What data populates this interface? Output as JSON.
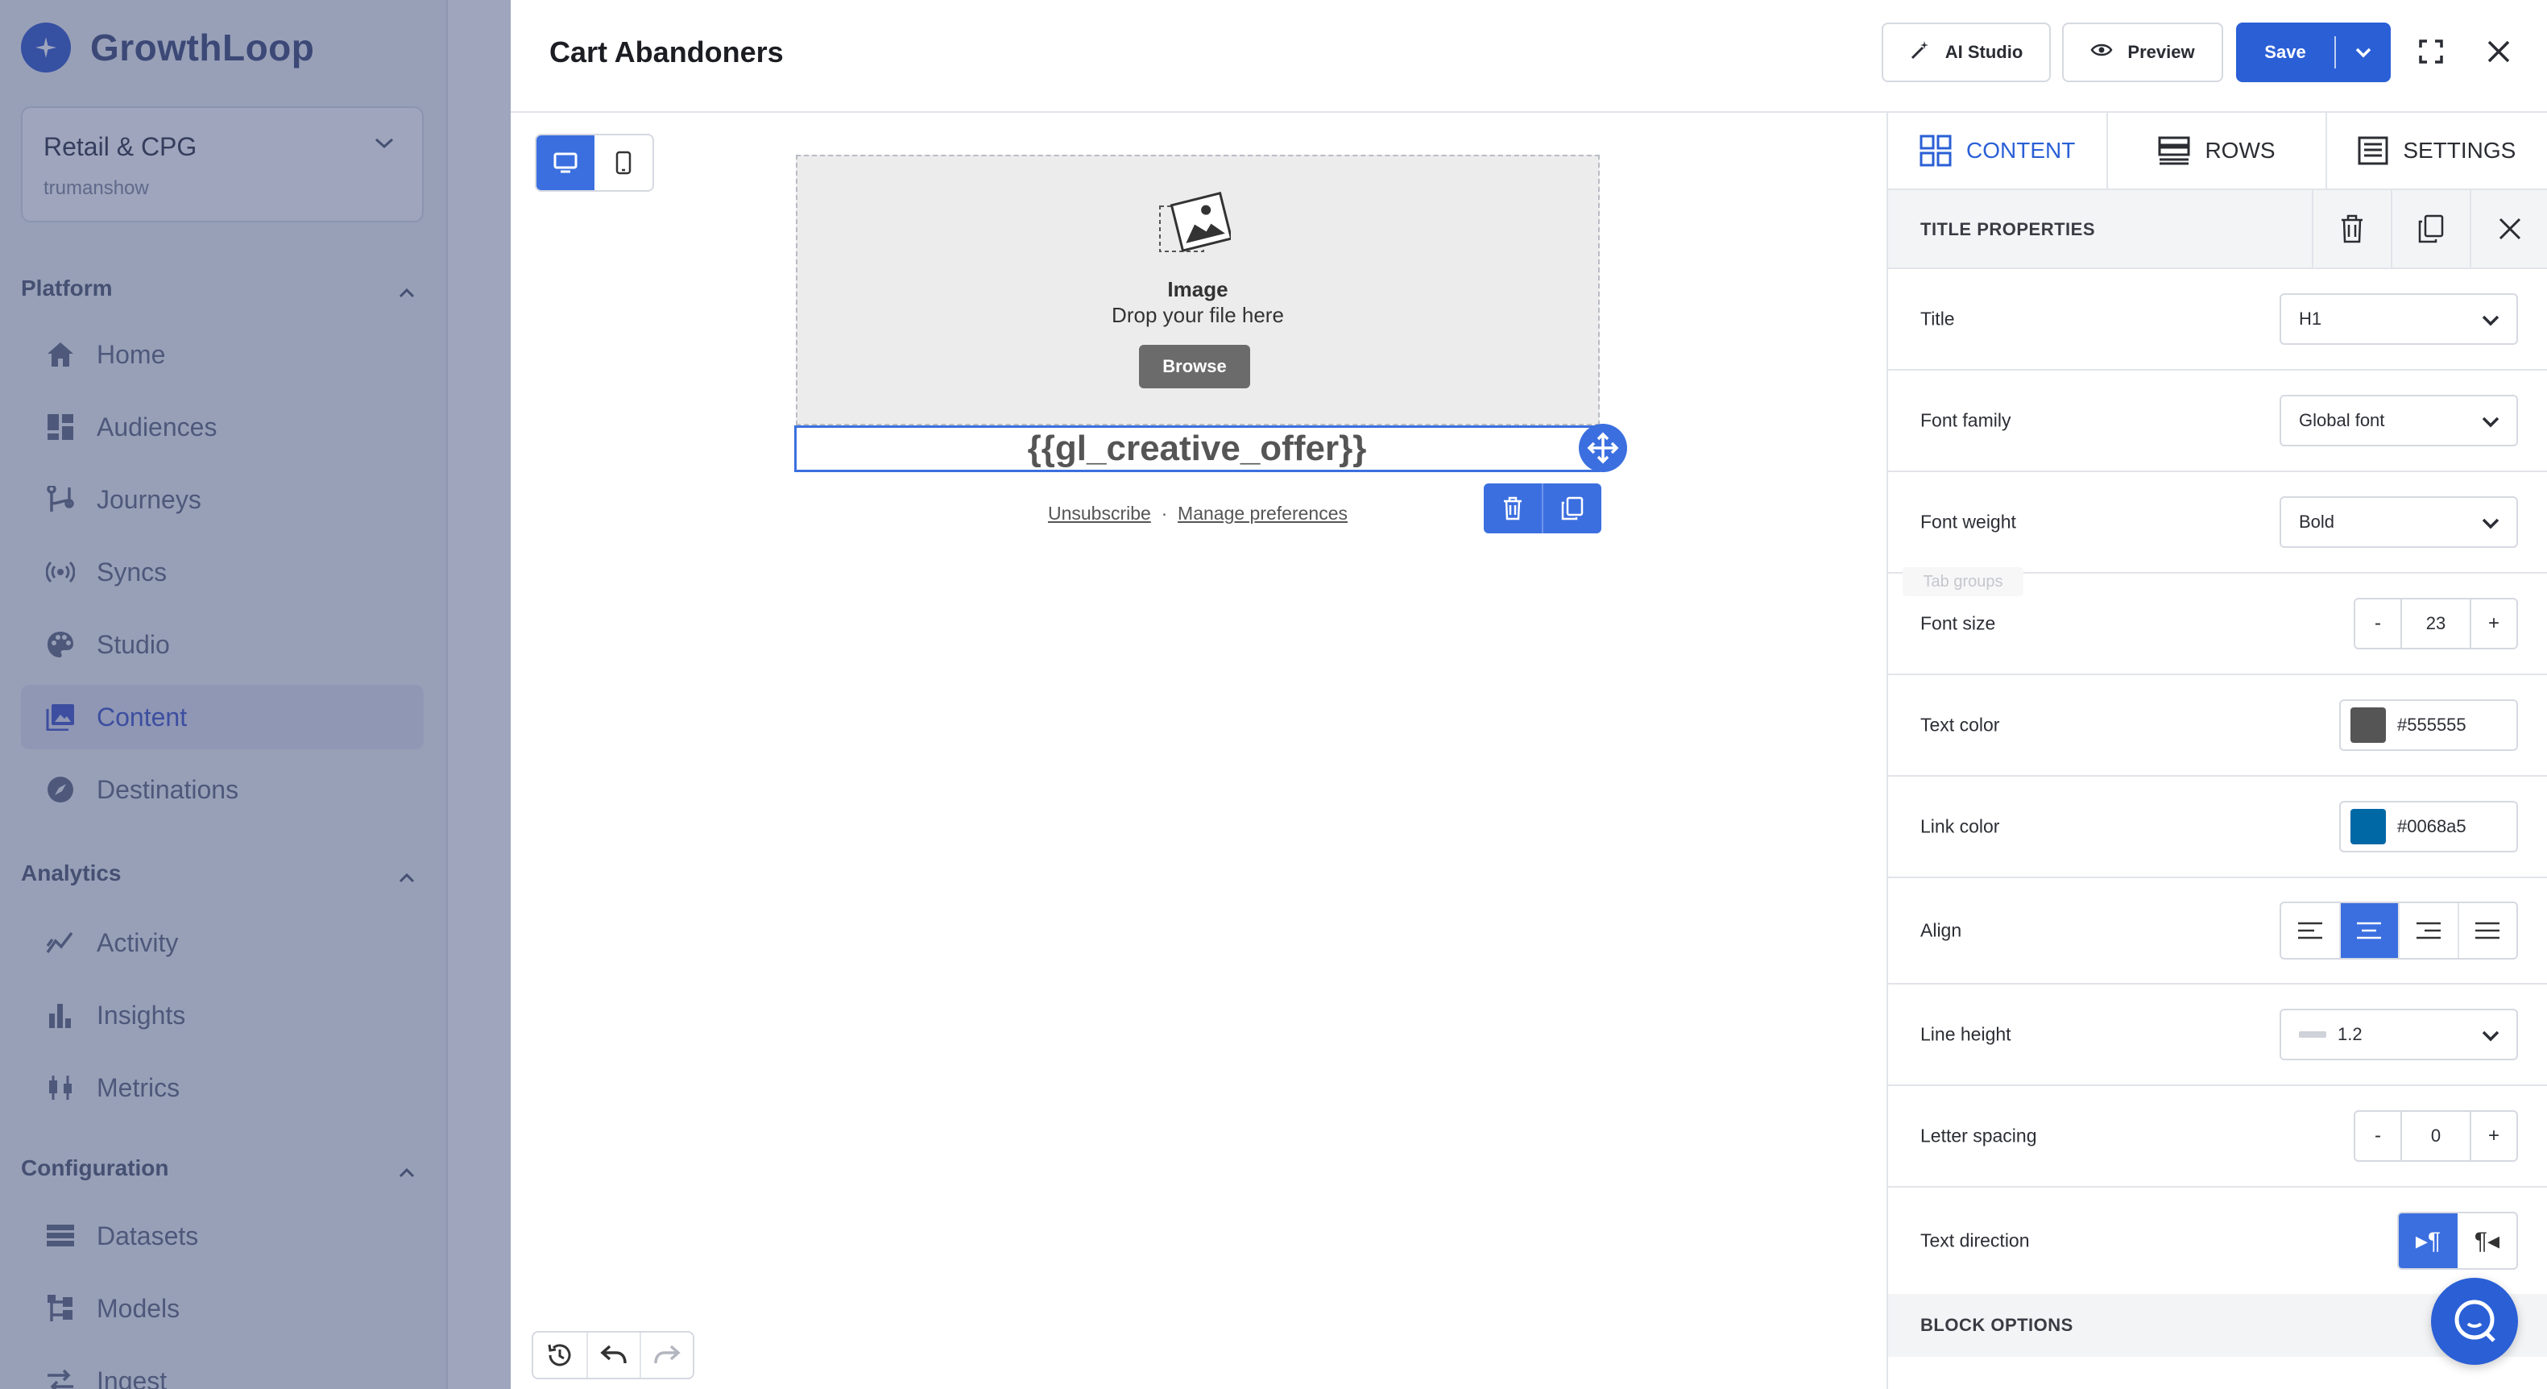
{
  "sidebar": {
    "brand": "GrowthLoop",
    "workspace": {
      "name": "Retail & CPG",
      "user": "trumanshow"
    },
    "sections": [
      {
        "title": "Platform",
        "items": [
          {
            "label": "Home",
            "icon": "home-icon"
          },
          {
            "label": "Audiences",
            "icon": "grid-icon"
          },
          {
            "label": "Journeys",
            "icon": "journey-icon"
          },
          {
            "label": "Syncs",
            "icon": "broadcast-icon"
          },
          {
            "label": "Studio",
            "icon": "palette-icon"
          },
          {
            "label": "Content",
            "icon": "image-icon",
            "active": true
          },
          {
            "label": "Destinations",
            "icon": "compass-icon"
          }
        ]
      },
      {
        "title": "Analytics",
        "items": [
          {
            "label": "Activity",
            "icon": "activity-icon"
          },
          {
            "label": "Insights",
            "icon": "bar-chart-icon"
          },
          {
            "label": "Metrics",
            "icon": "metrics-icon"
          }
        ]
      },
      {
        "title": "Configuration",
        "items": [
          {
            "label": "Datasets",
            "icon": "database-icon"
          },
          {
            "label": "Models",
            "icon": "model-icon"
          },
          {
            "label": "Ingest",
            "icon": "ingest-icon"
          }
        ]
      }
    ]
  },
  "editor": {
    "title": "Cart Abandoners",
    "toolbar": {
      "ai_studio": "AI Studio",
      "preview": "Preview",
      "save": "Save"
    },
    "canvas": {
      "image_block": {
        "label": "Image",
        "drop_text": "Drop your file here",
        "browse": "Browse"
      },
      "title_text": "{{gl_creative_offer}}",
      "footer": {
        "unsubscribe": "Unsubscribe",
        "separator": "·",
        "manage": "Manage preferences"
      }
    }
  },
  "panel": {
    "tabs": [
      "CONTENT",
      "ROWS",
      "SETTINGS"
    ],
    "active_tab": "CONTENT",
    "header": "TITLE PROPERTIES",
    "tooltip_ghost": "Tab groups",
    "properties": {
      "title": {
        "label": "Title",
        "value": "H1"
      },
      "font_family": {
        "label": "Font family",
        "value": "Global font"
      },
      "font_weight": {
        "label": "Font weight",
        "value": "Bold"
      },
      "font_size": {
        "label": "Font size",
        "value": "23",
        "minus": "-",
        "plus": "+"
      },
      "text_color": {
        "label": "Text color",
        "value": "#555555"
      },
      "link_color": {
        "label": "Link color",
        "value": "#0068a5"
      },
      "align": {
        "label": "Align",
        "selected": "center"
      },
      "line_height": {
        "label": "Line height",
        "value": "1.2"
      },
      "letter_spacing": {
        "label": "Letter spacing",
        "value": "0",
        "minus": "-",
        "plus": "+"
      },
      "text_direction": {
        "label": "Text direction",
        "selected": "ltr"
      }
    },
    "block_options": "BLOCK OPTIONS"
  },
  "colors": {
    "accent": "#2a5fd6",
    "accent_light": "#3b6fe0",
    "text_color": "#555555",
    "link_color": "#0068a5"
  }
}
